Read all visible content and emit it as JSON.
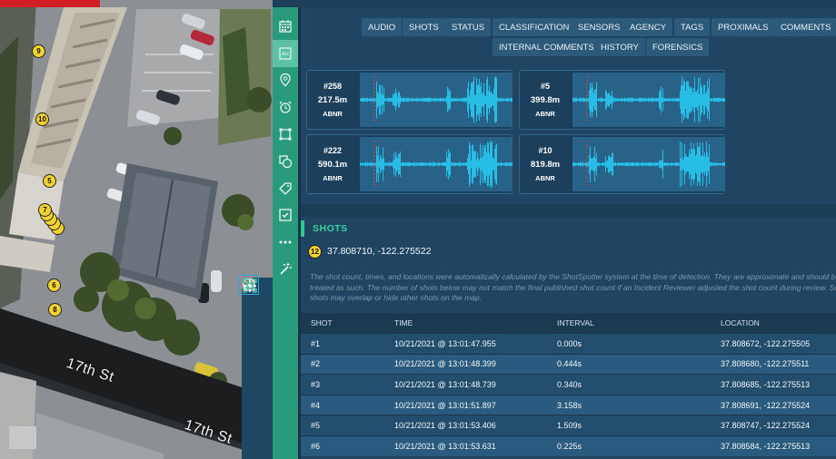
{
  "tabs": [
    "AUDIO",
    "SHOTS",
    "STATUS",
    "CLASSIFICATION",
    "SENSORS",
    "AGENCY",
    "TAGS",
    "PROXIMALS",
    "COMMENTS",
    "INTERNAL COMMENTS",
    "HISTORY",
    "FORENSICS"
  ],
  "waveforms": [
    {
      "id": "#258",
      "distance": "217.5m",
      "status": "ABNR"
    },
    {
      "id": "#5",
      "distance": "399.8m",
      "status": "ABNR"
    },
    {
      "id": "#222",
      "distance": "590.1m",
      "status": "ABNR"
    },
    {
      "id": "#10",
      "distance": "819.8m",
      "status": "ABNR"
    }
  ],
  "shots": {
    "section_title": "SHOTS",
    "marker_label": "12",
    "coordinates": "37.808710, -122.275522",
    "disclaimer": "The shot count, times, and locations were automatically calculated by the ShotSpotter system at the time of detection. They are approximate and should be treated as such. The number of shots below may not match the final published shot count if an Incident Reviewer adjusted the shot count during review. Some shots may overlap or hide other shots on the map.",
    "columns": [
      "SHOT",
      "TIME",
      "INTERVAL",
      "LOCATION"
    ],
    "rows": [
      {
        "shot": "#1",
        "time": "10/21/2021 @ 13:01:47.955",
        "interval": "0.000s",
        "location": "37.808672, -122.275505"
      },
      {
        "shot": "#2",
        "time": "10/21/2021 @ 13:01:48.399",
        "interval": "0.444s",
        "location": "37.808680, -122.275511"
      },
      {
        "shot": "#3",
        "time": "10/21/2021 @ 13:01:48.739",
        "interval": "0.340s",
        "location": "37.808685, -122.275513"
      },
      {
        "shot": "#4",
        "time": "10/21/2021 @ 13:01:51.897",
        "interval": "3.158s",
        "location": "37.808691, -122.275524"
      },
      {
        "shot": "#5",
        "time": "10/21/2021 @ 13:01:53.406",
        "interval": "1.509s",
        "location": "37.808747, -122.275524"
      },
      {
        "shot": "#6",
        "time": "10/21/2021 @ 13:01:53.631",
        "interval": "0.225s",
        "location": "37.808584, -122.275513"
      }
    ]
  },
  "map": {
    "street_labels": [
      "17th St",
      "17th St"
    ],
    "markers": [
      "9",
      "10",
      "5",
      "7",
      "6",
      "8"
    ]
  },
  "rail_icons": [
    "calendar-icon",
    "text-block-icon",
    "location-pin-icon",
    "alarm-icon",
    "polygon-icon",
    "shapes-icon",
    "tag-icon",
    "checkbox-icon",
    "more-icon",
    "magic-wand-icon"
  ],
  "map_tools": [
    "pencil-icon",
    "pin-drop-icon",
    "map-layers-icon",
    "zoom-in-icon",
    "zoom-out-icon",
    "fit-bounds-icon"
  ],
  "colors": {
    "accent_green": "#2fc98f",
    "rail": "#2a9a7d",
    "waveform": "#27c8f0",
    "marker": "#f2d230",
    "header_red": "#d21f26"
  }
}
